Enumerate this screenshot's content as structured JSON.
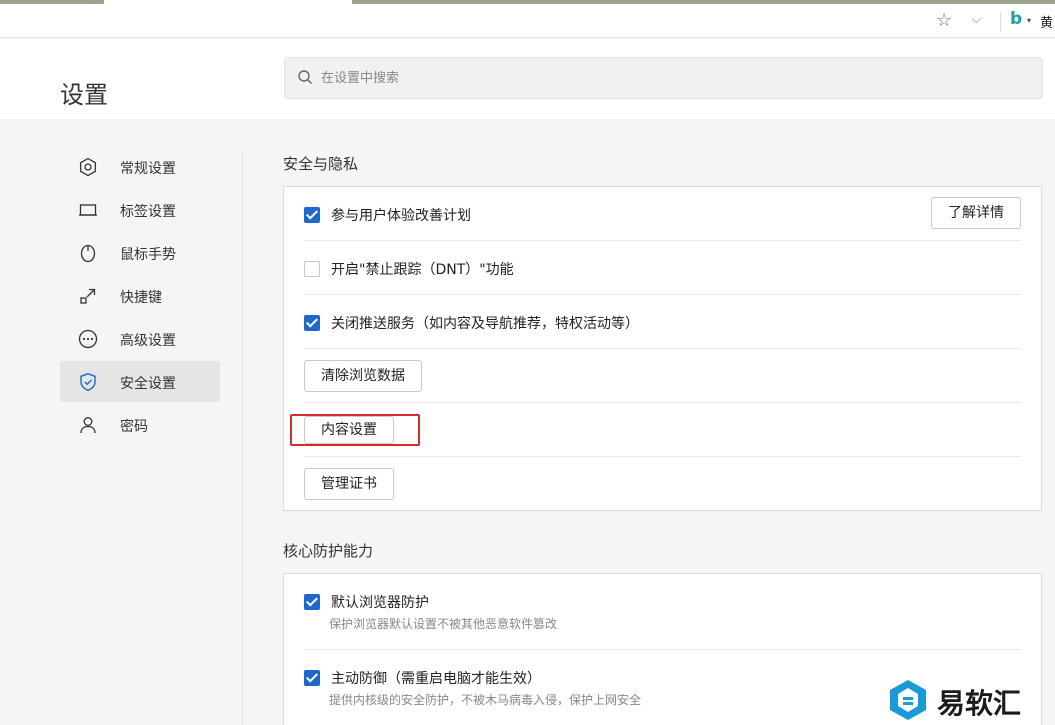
{
  "toolbar": {
    "user_label": "黄"
  },
  "header": {
    "title": "设置",
    "search_placeholder": "在设置中搜索"
  },
  "sidebar": {
    "items": [
      {
        "label": "常规设置",
        "icon": "gear-icon"
      },
      {
        "label": "标签设置",
        "icon": "tab-icon"
      },
      {
        "label": "鼠标手势",
        "icon": "mouse-icon"
      },
      {
        "label": "快捷键",
        "icon": "shortcut-icon"
      },
      {
        "label": "高级设置",
        "icon": "more-icon"
      },
      {
        "label": "安全设置",
        "icon": "shield-icon",
        "active": true
      },
      {
        "label": "密码",
        "icon": "user-icon"
      }
    ]
  },
  "security": {
    "title": "安全与隐私",
    "ux_program": {
      "label": "参与用户体验改善计划",
      "checked": true,
      "button": "了解详情"
    },
    "dnt": {
      "label": "开启\"禁止跟踪（DNT）\"功能",
      "checked": false
    },
    "push": {
      "label": "关闭推送服务（如内容及导航推荐，特权活动等）",
      "checked": true
    },
    "clear_data_button": "清除浏览数据",
    "content_settings_button": "内容设置",
    "certificates_button": "管理证书"
  },
  "core": {
    "title": "核心防护能力",
    "items": [
      {
        "label": "默认浏览器防护",
        "desc": "保护浏览器默认设置不被其他恶意软件篡改",
        "checked": true
      },
      {
        "label": "主动防御（需重启电脑才能生效）",
        "desc": "提供内核级的安全防护，不被木马病毒入侵，保护上网安全",
        "checked": true
      }
    ]
  },
  "watermark": {
    "text": "易软汇"
  },
  "colors": {
    "accent": "#1f67c9",
    "highlight": "#d9292b"
  }
}
